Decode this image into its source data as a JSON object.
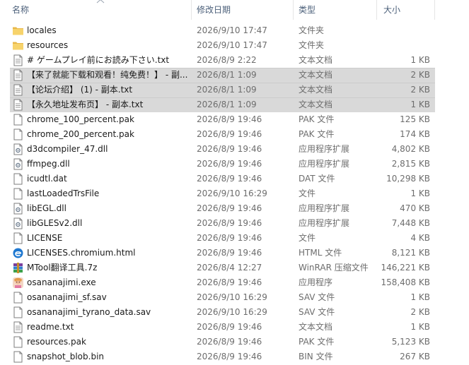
{
  "columns": {
    "name": "名称",
    "date": "修改日期",
    "type": "类型",
    "size": "大小"
  },
  "files": [
    {
      "name": "locales",
      "date": "2026/9/10 17:47",
      "type": "文件夹",
      "size": "",
      "icon": "folder-icon",
      "selected": false
    },
    {
      "name": "resources",
      "date": "2026/9/10 17:47",
      "type": "文件夹",
      "size": "",
      "icon": "folder-icon",
      "selected": false
    },
    {
      "name": "# ゲームプレイ前にお読み下さい.txt",
      "date": "2026/8/9 2:22",
      "type": "文本文档",
      "size": "1 KB",
      "icon": "text-file-icon",
      "selected": false
    },
    {
      "name": "【来了就能下载和观看！纯免费！】 - 副...",
      "date": "2026/8/1 1:09",
      "type": "文本文档",
      "size": "2 KB",
      "icon": "text-file-icon",
      "selected": true
    },
    {
      "name": "【论坛介绍】 (1) - 副本.txt",
      "date": "2026/8/1 1:09",
      "type": "文本文档",
      "size": "2 KB",
      "icon": "text-file-icon",
      "selected": true
    },
    {
      "name": "【永久地址发布页】 - 副本.txt",
      "date": "2026/8/1 1:09",
      "type": "文本文档",
      "size": "1 KB",
      "icon": "text-file-icon",
      "selected": true
    },
    {
      "name": "chrome_100_percent.pak",
      "date": "2026/8/9 19:46",
      "type": "PAK 文件",
      "size": "125 KB",
      "icon": "blank-file-icon",
      "selected": false
    },
    {
      "name": "chrome_200_percent.pak",
      "date": "2026/8/9 19:46",
      "type": "PAK 文件",
      "size": "174 KB",
      "icon": "blank-file-icon",
      "selected": false
    },
    {
      "name": "d3dcompiler_47.dll",
      "date": "2026/8/9 19:46",
      "type": "应用程序扩展",
      "size": "4,802 KB",
      "icon": "dll-file-icon",
      "selected": false
    },
    {
      "name": "ffmpeg.dll",
      "date": "2026/8/9 19:46",
      "type": "应用程序扩展",
      "size": "2,815 KB",
      "icon": "dll-file-icon",
      "selected": false
    },
    {
      "name": "icudtl.dat",
      "date": "2026/8/9 19:46",
      "type": "DAT 文件",
      "size": "10,298 KB",
      "icon": "blank-file-icon",
      "selected": false
    },
    {
      "name": "lastLoadedTrsFile",
      "date": "2026/9/10 16:29",
      "type": "文件",
      "size": "1 KB",
      "icon": "blank-file-icon",
      "selected": false
    },
    {
      "name": "libEGL.dll",
      "date": "2026/8/9 19:46",
      "type": "应用程序扩展",
      "size": "470 KB",
      "icon": "dll-file-icon",
      "selected": false
    },
    {
      "name": "libGLESv2.dll",
      "date": "2026/8/9 19:46",
      "type": "应用程序扩展",
      "size": "7,448 KB",
      "icon": "dll-file-icon",
      "selected": false
    },
    {
      "name": "LICENSE",
      "date": "2026/8/9 19:46",
      "type": "文件",
      "size": "4 KB",
      "icon": "blank-file-icon",
      "selected": false
    },
    {
      "name": "LICENSES.chromium.html",
      "date": "2026/8/9 19:46",
      "type": "HTML 文件",
      "size": "8,121 KB",
      "icon": "edge-html-icon",
      "selected": false
    },
    {
      "name": "MTool翻译工具.7z",
      "date": "2026/8/4 12:27",
      "type": "WinRAR 压缩文件",
      "size": "146,221 KB",
      "icon": "winrar-archive-icon",
      "selected": false
    },
    {
      "name": "osananajimi.exe",
      "date": "2026/8/9 19:46",
      "type": "应用程序",
      "size": "158,408 KB",
      "icon": "app-exe-icon",
      "selected": false
    },
    {
      "name": "osananajimi_sf.sav",
      "date": "2026/9/10 16:29",
      "type": "SAV 文件",
      "size": "1 KB",
      "icon": "blank-file-icon",
      "selected": false
    },
    {
      "name": "osananajimi_tyrano_data.sav",
      "date": "2026/9/10 16:29",
      "type": "SAV 文件",
      "size": "2 KB",
      "icon": "blank-file-icon",
      "selected": false
    },
    {
      "name": "readme.txt",
      "date": "2026/8/9 19:46",
      "type": "文本文档",
      "size": "1 KB",
      "icon": "text-file-icon",
      "selected": false
    },
    {
      "name": "resources.pak",
      "date": "2026/8/9 19:46",
      "type": "PAK 文件",
      "size": "5,123 KB",
      "icon": "blank-file-icon",
      "selected": false
    },
    {
      "name": "snapshot_blob.bin",
      "date": "2026/8/9 19:46",
      "type": "BIN 文件",
      "size": "267 KB",
      "icon": "blank-file-icon",
      "selected": false
    }
  ]
}
